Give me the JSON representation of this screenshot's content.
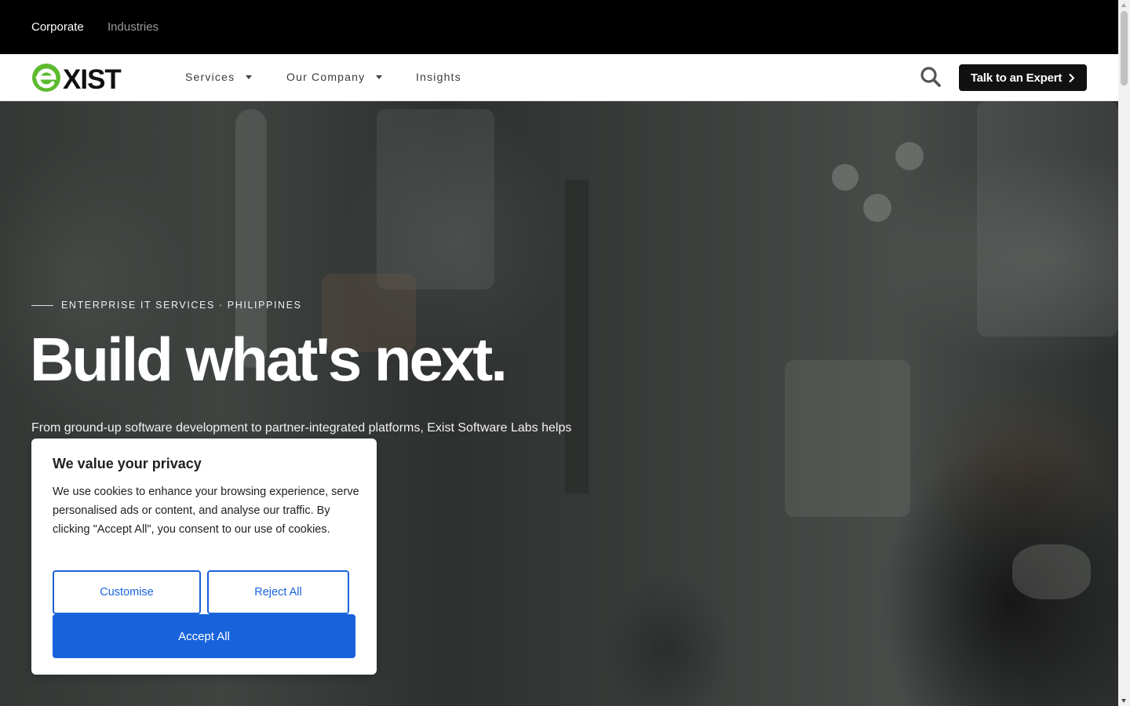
{
  "topbar": {
    "corporate": "Corporate",
    "industries": "Industries"
  },
  "brand": {
    "logo_text": "EXIST",
    "logo_color": "#5dba2f"
  },
  "nav": {
    "items": [
      {
        "label": "Services",
        "has_dropdown": true
      },
      {
        "label": "Our Company",
        "has_dropdown": true
      },
      {
        "label": "Insights",
        "has_dropdown": false
      }
    ],
    "search_icon": "search-icon",
    "cta_label": "Talk to an Expert"
  },
  "hero": {
    "eyebrow": "ENTERPRISE IT SERVICES · PHILIPPINES",
    "headline": "Build what's next.",
    "lead": "From ground-up software development to partner-integrated platforms, Exist Software Labs helps measurable impact."
  },
  "cookie": {
    "title": "We value your privacy",
    "body": "We use cookies to enhance your browsing experience, serve personalised ads or content, and analyse our traffic. By clicking \"Accept All\", you consent to our use of cookies.",
    "customise": "Customise",
    "reject": "Reject All",
    "accept": "Accept All",
    "accent_color": "#1863dc"
  }
}
